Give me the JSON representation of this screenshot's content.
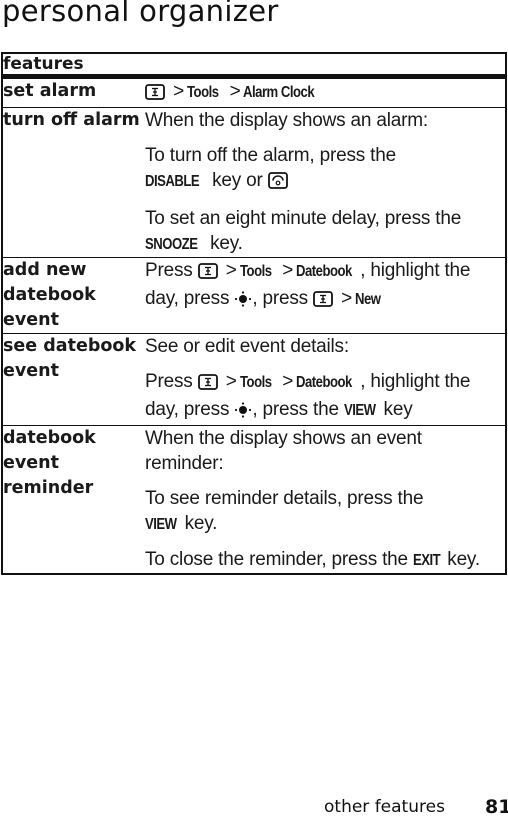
{
  "page": {
    "title": "personal organizer",
    "footer_section": "other features",
    "page_number": "81"
  },
  "table": {
    "header": "features",
    "rows": [
      {
        "feature": "set alarm",
        "path": [
          "menu-key-icon",
          "Tools",
          "Alarm Clock"
        ]
      },
      {
        "feature": "turn off alarm",
        "line1": "When the display shows an alarm:",
        "line2_pre": "To turn off the alarm, press the",
        "line2_key": "DISABLE",
        "line2_post": "key or",
        "line2_icon": "end-power-key-icon",
        "line3_pre": "To set an eight minute delay, press the",
        "line3_key": "SNOOZE",
        "line3_post": "key."
      },
      {
        "feature": "add new datebook event",
        "press": "Press",
        "tools": "Tools",
        "datebook": "Datebook",
        "mid": ", highlight the day, press",
        "mid2": ", press",
        "new": "New"
      },
      {
        "feature": "see datebook event",
        "line1": "See or edit event details:",
        "press": "Press",
        "tools": "Tools",
        "datebook": "Datebook",
        "mid": ", highlight the day, press",
        "mid2": ", press the",
        "view": "VIEW",
        "end": "key"
      },
      {
        "feature": "datebook event reminder",
        "line1": "When the display shows an event reminder:",
        "line2_pre": "To see reminder details, press the",
        "line2_key": "VIEW",
        "line2_post": "key.",
        "line3_pre": "To close the reminder, press the",
        "line3_key": "EXIT",
        "line3_post": "key."
      }
    ],
    "separator": ">"
  }
}
